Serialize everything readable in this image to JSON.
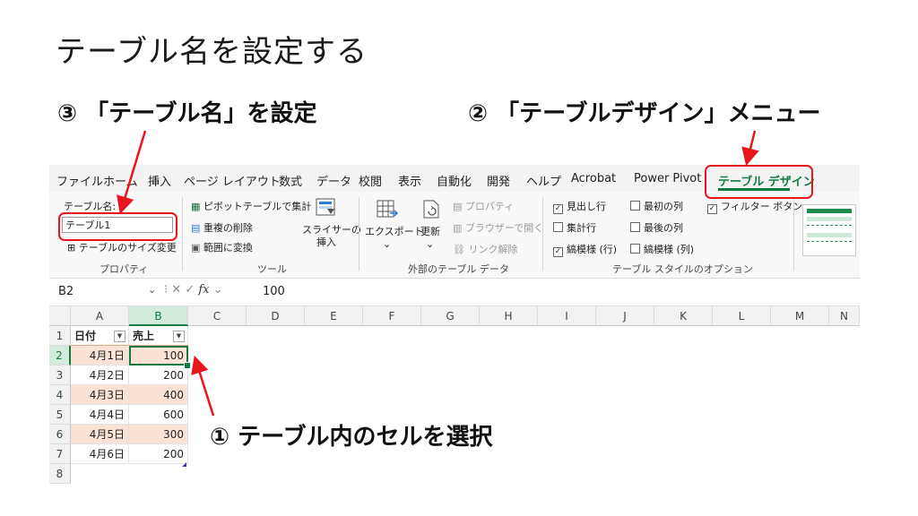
{
  "slide": {
    "title": "テーブル名を設定する",
    "callout_step3": "③ 「テーブル名」を設定",
    "callout_step2": "② 「テーブルデザイン」メニュー",
    "callout_step1": "① テーブル内のセルを選択"
  },
  "ribbon_tabs": [
    "ファイル",
    "ホーム",
    "挿入",
    "ページ レイアウト",
    "数式",
    "データ",
    "校閲",
    "表示",
    "自動化",
    "開発",
    "ヘルプ",
    "Acrobat",
    "Power Pivot",
    "テーブル デザイン"
  ],
  "active_tab": "テーブル デザイン",
  "ribbon": {
    "properties": {
      "table_name_label": "テーブル名:",
      "table_name_value": "テーブル1",
      "resize_label": "テーブルのサイズ変更",
      "group_label": "プロパティ"
    },
    "tools": {
      "pivot_label": "ピボットテーブルで集計",
      "remove_dup_label": "重複の削除",
      "convert_range_label": "範囲に変換",
      "slicer_label_1": "スライサーの",
      "slicer_label_2": "挿入",
      "group_label": "ツール"
    },
    "external": {
      "export_label": "エクスポート",
      "refresh_label": "更新",
      "properties_label": "プロパティ",
      "open_browser_label": "ブラウザーで開く",
      "unlink_label": "リンク解除",
      "group_label": "外部のテーブル データ"
    },
    "style_options": {
      "header_row": {
        "label": "見出し行",
        "checked": true
      },
      "total_row": {
        "label": "集計行",
        "checked": false
      },
      "banded_rows": {
        "label": "縞模様 (行)",
        "checked": true
      },
      "first_column": {
        "label": "最初の列",
        "checked": false
      },
      "last_column": {
        "label": "最後の列",
        "checked": false
      },
      "banded_columns": {
        "label": "縞模様 (列)",
        "checked": false
      },
      "filter_button": {
        "label": "フィルター ボタン",
        "checked": true
      },
      "group_label": "テーブル スタイルのオプション"
    }
  },
  "formula_bar": {
    "name_box": "B2",
    "fx": "fx",
    "value": "100"
  },
  "columns": [
    "A",
    "B",
    "C",
    "D",
    "E",
    "F",
    "G",
    "H",
    "I",
    "J",
    "K",
    "L",
    "M",
    "N"
  ],
  "rows": [
    "1",
    "2",
    "3",
    "4",
    "5",
    "6",
    "7",
    "8"
  ],
  "table": {
    "headers": [
      "日付",
      "売上"
    ],
    "rows": [
      [
        "4月1日",
        "100"
      ],
      [
        "4月2日",
        "200"
      ],
      [
        "4月3日",
        "400"
      ],
      [
        "4月4日",
        "600"
      ],
      [
        "4月5日",
        "300"
      ],
      [
        "4月6日",
        "200"
      ]
    ]
  },
  "colors": {
    "accent_green": "#107c41",
    "highlight_red": "#e8161c",
    "band_orange": "#fbe2d5"
  }
}
